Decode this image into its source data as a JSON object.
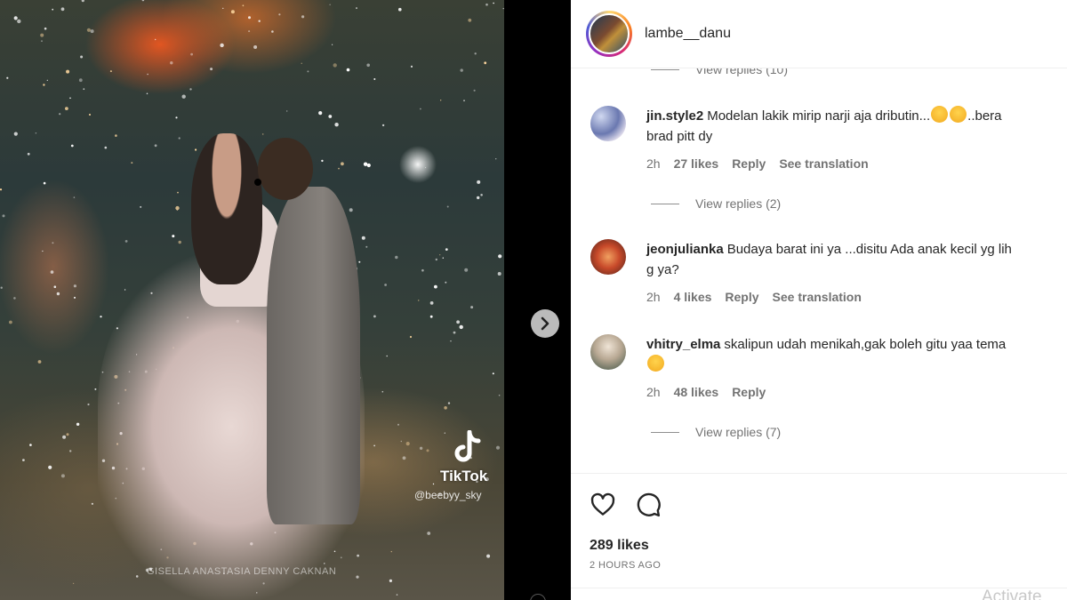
{
  "post": {
    "username": "lambe__danu",
    "likes": "289 likes",
    "time_ago": "2 HOURS AGO"
  },
  "video": {
    "tiktok_label": "TikTok",
    "tiktok_handle": "@beebyy_sky",
    "bottom_caption": "GISELLA ANASTASIA DENNY CAKNAN"
  },
  "comments": {
    "top_replies": "View replies (10)",
    "items": [
      {
        "user": "jin.style2",
        "text_line1": "Modelan lakik mirip narji aja dributin...",
        "text_line1_after": "..bera",
        "text_line2": "brad pitt dy",
        "emoji_count": 2,
        "time": "2h",
        "likes": "27 likes",
        "reply": "Reply",
        "translation": "See translation",
        "view_replies": "View replies (2)"
      },
      {
        "user": "jeonjulianka",
        "text_line1": "Budaya barat ini ya ...disitu Ada anak kecil yg lih",
        "text_line2": "g ya?",
        "time": "2h",
        "likes": "4 likes",
        "reply": "Reply",
        "translation": "See translation"
      },
      {
        "user": "vhitry_elma",
        "text_line1": "skalipun udah menikah,gak boleh gitu yaa tema",
        "text_line2": "",
        "emoji_count": 1,
        "time": "2h",
        "likes": "48 likes",
        "reply": "Reply",
        "view_replies": "View replies (7)"
      }
    ]
  },
  "watermark": "Activate",
  "icons": {
    "like": "heart-icon",
    "comment": "comment-icon",
    "next": "chevron-right-icon",
    "tiktok": "tiktok-logo-icon"
  },
  "colors": {
    "panel_bg": "#ffffff",
    "text": "#262626",
    "muted": "#737373",
    "divider": "#efefef"
  }
}
